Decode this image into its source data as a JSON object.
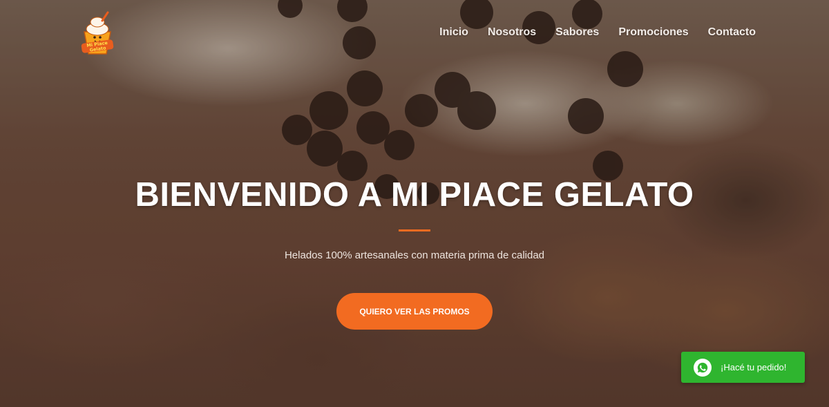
{
  "header": {
    "logo_lines": [
      "Mi Piace",
      "Gelato"
    ]
  },
  "nav": {
    "items": [
      "Inicio",
      "Nosotros",
      "Sabores",
      "Promociones",
      "Contacto"
    ]
  },
  "hero": {
    "title": "BIENVENIDO A MI PIACE GELATO",
    "subtitle": "Helados 100% artesanales con materia prima de calidad",
    "cta_label": "QUIERO VER LAS PROMOS"
  },
  "whatsapp": {
    "label": "¡Hacé tu pedido!",
    "icon": "whatsapp-icon"
  },
  "colors": {
    "accent": "#f26b21",
    "whatsapp": "#2fb52f"
  }
}
